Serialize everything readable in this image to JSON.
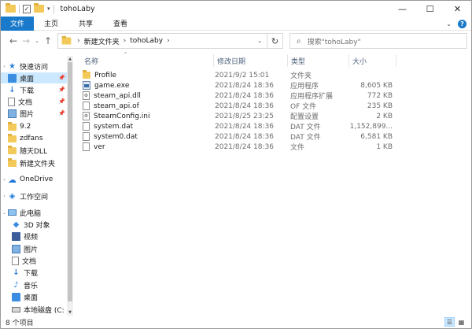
{
  "window": {
    "title": "tohoLaby"
  },
  "quick_access_toolbar": {
    "items": [
      "folder-icon",
      "properties-icon",
      "new-folder-icon"
    ]
  },
  "window_controls": {
    "minimize": "—",
    "maximize": "☐",
    "close": "✕"
  },
  "ribbon": {
    "tabs": [
      {
        "label": "文件"
      },
      {
        "label": "主页"
      },
      {
        "label": "共享"
      },
      {
        "label": "查看"
      }
    ],
    "expand_glyph": "⌄",
    "help_glyph": "?"
  },
  "navigation": {
    "back_glyph": "←",
    "forward_glyph": "→",
    "recent_glyph": "⌄",
    "up_glyph": "↑",
    "breadcrumb": [
      "新建文件夹",
      "tohoLaby"
    ],
    "crumb_separator": "›",
    "refresh_glyph": "↻",
    "dropdown_glyph": "⌄"
  },
  "search": {
    "placeholder": "搜索\"tohoLaby\"",
    "glyph": "⌕"
  },
  "sidebar": {
    "items": [
      {
        "label": "快速访问",
        "icon": "star-icon",
        "pinned": false
      },
      {
        "label": "桌面",
        "icon": "desktop-icon",
        "pinned": true
      },
      {
        "label": "下载",
        "icon": "download-icon",
        "pinned": true
      },
      {
        "label": "文档",
        "icon": "documents-icon",
        "pinned": true
      },
      {
        "label": "图片",
        "icon": "pictures-icon",
        "pinned": true
      },
      {
        "label": "9.2",
        "icon": "folder-icon",
        "pinned": false
      },
      {
        "label": "zdfans",
        "icon": "folder-icon",
        "pinned": false
      },
      {
        "label": "随天DLL",
        "icon": "folder-icon",
        "pinned": false
      },
      {
        "label": "新建文件夹",
        "icon": "folder-icon",
        "pinned": false
      },
      {
        "label": "OneDrive",
        "icon": "cloud-icon",
        "pinned": false
      },
      {
        "label": "工作空间",
        "icon": "network-icon",
        "pinned": false
      },
      {
        "label": "此电脑",
        "icon": "computer-icon",
        "pinned": false
      },
      {
        "label": "3D 对象",
        "icon": "3d-objects-icon",
        "pinned": false
      },
      {
        "label": "视频",
        "icon": "videos-icon",
        "pinned": false
      },
      {
        "label": "图片",
        "icon": "pictures-icon",
        "pinned": false
      },
      {
        "label": "文档",
        "icon": "documents-icon",
        "pinned": false
      },
      {
        "label": "下载",
        "icon": "download-icon",
        "pinned": false
      },
      {
        "label": "音乐",
        "icon": "music-icon",
        "pinned": false
      },
      {
        "label": "桌面",
        "icon": "desktop-icon",
        "pinned": false
      },
      {
        "label": "本地磁盘 (C:",
        "icon": "disk-icon",
        "pinned": false
      }
    ],
    "pin_glyph": "📌"
  },
  "file_list": {
    "columns": {
      "name": "名称",
      "date": "修改日期",
      "type": "类型",
      "size": "大小"
    },
    "sort_glyph": "^",
    "rows": [
      {
        "name": "Profile",
        "date": "2021/9/2 15:01",
        "type": "文件夹",
        "size": "",
        "icon": "folder-icon"
      },
      {
        "name": "game.exe",
        "date": "2021/8/24 18:36",
        "type": "应用程序",
        "size": "8,605 KB",
        "icon": "exe-icon"
      },
      {
        "name": "steam_api.dll",
        "date": "2021/8/24 18:36",
        "type": "应用程序扩展",
        "size": "772 KB",
        "icon": "dll-icon"
      },
      {
        "name": "steam_api.of",
        "date": "2021/8/24 18:36",
        "type": "OF 文件",
        "size": "235 KB",
        "icon": "file-icon"
      },
      {
        "name": "SteamConfig.ini",
        "date": "2021/8/25 23:25",
        "type": "配置设置",
        "size": "2 KB",
        "icon": "config-icon"
      },
      {
        "name": "system.dat",
        "date": "2021/8/24 18:36",
        "type": "DAT 文件",
        "size": "1,152,899...",
        "icon": "file-icon"
      },
      {
        "name": "system0.dat",
        "date": "2021/8/24 18:36",
        "type": "DAT 文件",
        "size": "6,581 KB",
        "icon": "file-icon"
      },
      {
        "name": "ver",
        "date": "2021/8/24 18:36",
        "type": "文件",
        "size": "1 KB",
        "icon": "file-icon"
      }
    ]
  },
  "status": {
    "item_count": "8 个项目"
  },
  "colors": {
    "accent": "#1979ca",
    "selection": "#cce8ff",
    "folder": "#f3c95a"
  }
}
